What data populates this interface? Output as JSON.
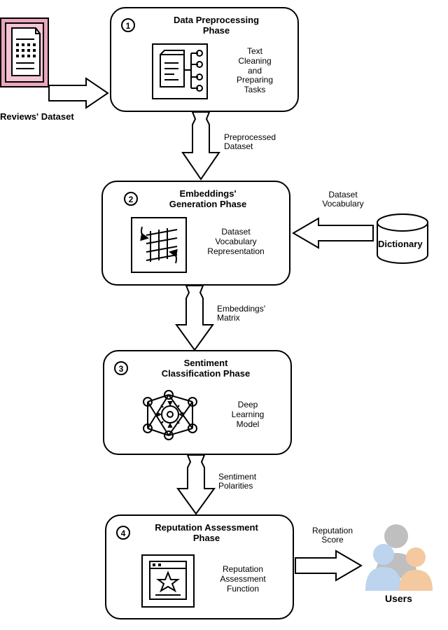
{
  "dataset_label": "Reviews' Dataset",
  "phases": [
    {
      "num": "1",
      "title": "Data Preprocessing\nPhase",
      "desc": "Text\nCleaning\nand\nPreparing\nTasks"
    },
    {
      "num": "2",
      "title": "Embeddings'\nGeneration Phase",
      "desc": "Dataset\nVocabulary\nRepresentation"
    },
    {
      "num": "3",
      "title": "Sentiment\nClassification Phase",
      "desc": "Deep\nLearning\nModel"
    },
    {
      "num": "4",
      "title": "Reputation Assessment\nPhase",
      "desc": "Reputation\nAssessment\nFunction"
    }
  ],
  "flows": {
    "pre_out": "Preprocessed\nDataset",
    "emb_in": "Dataset\nVocabulary",
    "emb_out": "Embeddings'\nMatrix",
    "sent_out": "Sentiment\nPolarities",
    "rep_out": "Reputation\nScore"
  },
  "dictionary_label": "Dictionary",
  "users_label": "Users"
}
